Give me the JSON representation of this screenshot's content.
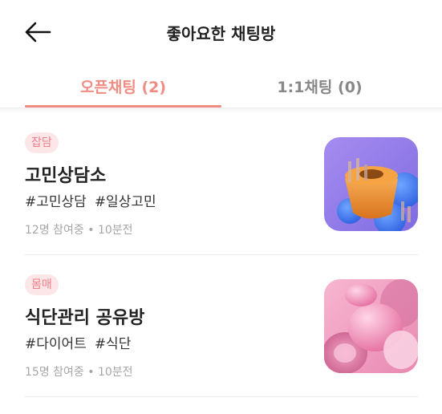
{
  "header": {
    "title": "좋아요한 채팅방",
    "back_icon": "arrow-left-icon"
  },
  "tabs": [
    {
      "label": "오픈채팅 (2)",
      "active": true
    },
    {
      "label": "1:1채팅 (0)",
      "active": false
    }
  ],
  "colors": {
    "accent": "#f08c84",
    "badge_bg": "#fde6e8",
    "badge_text": "#ef7f89"
  },
  "rooms": [
    {
      "badge": "잡담",
      "title": "고민상담소",
      "tags": [
        "#고민상담",
        "#일상고민"
      ],
      "participants": "12명 참여중",
      "separator": "•",
      "time": "10분전",
      "thumbnail": "abstract-3d-purple-orange-image"
    },
    {
      "badge": "몸매",
      "title": "식단관리 공유방",
      "tags": [
        "#다이어트",
        "#식단"
      ],
      "participants": "15명 참여중",
      "separator": "•",
      "time": "10분전",
      "thumbnail": "abstract-3d-pink-image"
    }
  ]
}
